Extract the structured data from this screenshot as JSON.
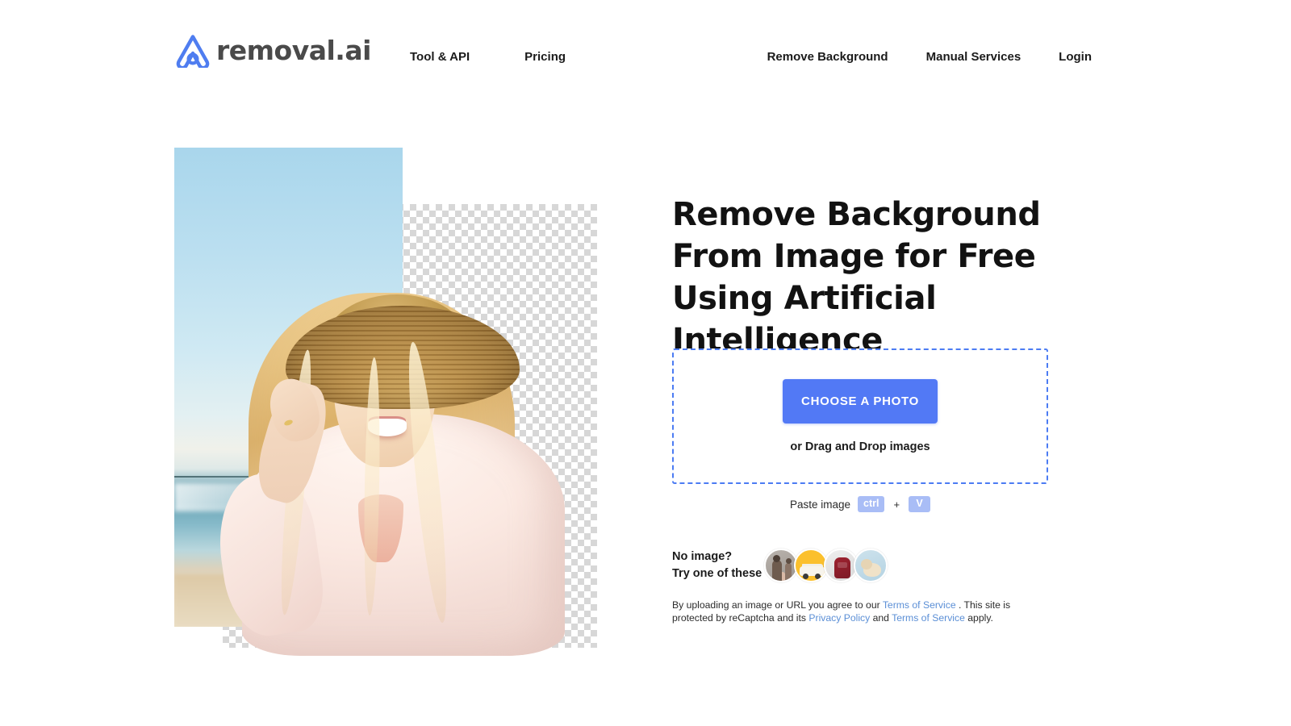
{
  "header": {
    "logo": {
      "icon": "removal-ai-logo-mark",
      "text": "removal.ai"
    },
    "nav_left": [
      {
        "label": "Tool & API"
      },
      {
        "label": "Pricing"
      }
    ],
    "nav_right": [
      {
        "label": "Remove Background"
      },
      {
        "label": "Manual Services"
      },
      {
        "label": "Login"
      }
    ]
  },
  "hero": {
    "image_alt": "smiling blonde woman in straw hat at the beach with background removed",
    "transparency_pattern": "checkerboard"
  },
  "main": {
    "headline": "Remove Background From Image for Free Using Artificial Intelligence",
    "dropzone": {
      "button_label": "CHOOSE A PHOTO",
      "drag_text": "or Drag and Drop images",
      "border_color": "#4c7cf3",
      "button_color": "#5279f5"
    },
    "paste": {
      "label": "Paste image",
      "key1": "ctrl",
      "plus": "+",
      "key2": "V",
      "key_color": "#a9bdf6"
    },
    "samples": {
      "line1": "No image?",
      "line2": "Try one of these",
      "thumbs": [
        {
          "name": "sample-family",
          "alt": "family portrait"
        },
        {
          "name": "sample-car",
          "alt": "white car on yellow background"
        },
        {
          "name": "sample-backpack",
          "alt": "red backpack"
        },
        {
          "name": "sample-dog",
          "alt": "puppy on blue background"
        }
      ]
    },
    "legal": {
      "part1": "By uploading an image or URL you agree to our ",
      "link1": "Terms of Service",
      "part2": " . This site is protected by reCaptcha and its ",
      "link2": "Privacy Policy",
      "part3": " and ",
      "link3": "Terms of Service",
      "part4": " apply.",
      "link_color": "#5b8fd6"
    }
  }
}
